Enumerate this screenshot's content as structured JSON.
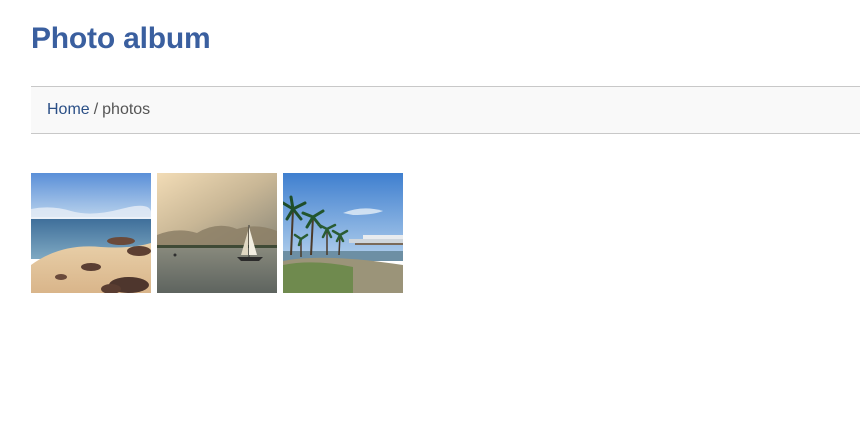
{
  "header": {
    "title": "Photo album"
  },
  "breadcrumb": {
    "home_label": "Home",
    "separator": "/",
    "current_label": "photos"
  },
  "gallery": {
    "photos": [
      {
        "subject": "beach-with-rocks"
      },
      {
        "subject": "sailboat-at-sunset"
      },
      {
        "subject": "palm-trees-and-pier"
      }
    ]
  },
  "colors": {
    "title": "#3a5f9f",
    "link": "#2a4f86",
    "breadcrumb_bg": "#f9f9f9"
  }
}
